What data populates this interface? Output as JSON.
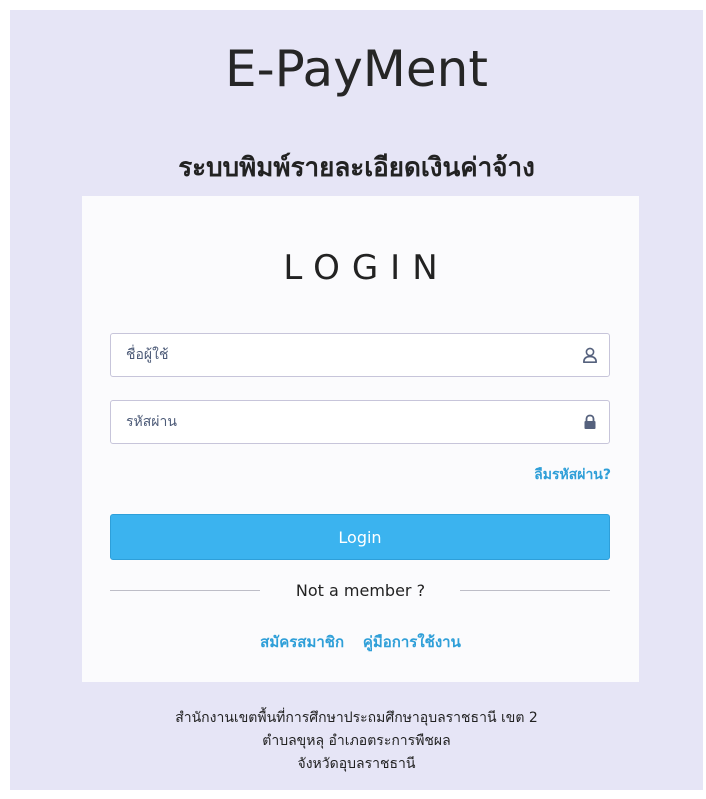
{
  "header": {
    "app_title": "E-PayMent",
    "subtitle": "ระบบพิมพ์รายละเอียดเงินค่าจ้าง"
  },
  "login": {
    "heading": "LOGIN",
    "username_placeholder": "ชื่อผู้ใช้",
    "password_placeholder": "รหัสผ่าน",
    "username_icon": "user-icon",
    "password_icon": "lock-icon",
    "forgot_password": "ลืมรหัสผ่าน?",
    "login_button": "Login",
    "not_member": "Not a member ?",
    "register_link": "สมัครสมาชิก",
    "manual_link": "คู่มือการใช้งาน"
  },
  "footer": {
    "line1": "สำนักงานเขตพื้นที่การศึกษาประถมศึกษาอุบลราชธานี เขต 2",
    "line2": "ตำบลขุหลุ อำเภอตระการพืชผล",
    "line3": "จังหวัดอุบลราชธานี"
  },
  "colors": {
    "page_background": "#e6e5f6",
    "card_background": "#fbfbfd",
    "accent": "#3bb3ef",
    "link": "#2f9fd8"
  }
}
